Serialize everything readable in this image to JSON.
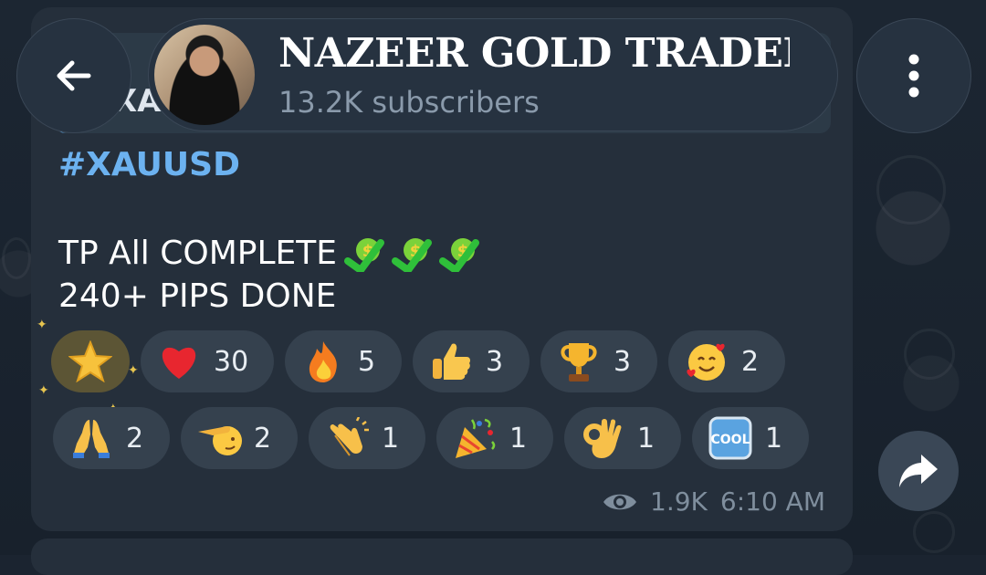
{
  "header": {
    "channel_name": "NAZEER GOLD TRADER",
    "subscribers": "13.2K subscribers"
  },
  "reply_preview": {
    "text": "XAU"
  },
  "message": {
    "hashtag": "#XAUUSD",
    "line1": "TP All COMPLETE",
    "line2": "240+ PIPS DONE",
    "views": "1.9K",
    "time": "6:10 AM"
  },
  "reactions": [
    {
      "icon": "star-icon",
      "count": ""
    },
    {
      "icon": "red-heart-icon",
      "count": "30"
    },
    {
      "icon": "fire-icon",
      "count": "5"
    },
    {
      "icon": "thumbs-up-icon",
      "count": "3"
    },
    {
      "icon": "trophy-icon",
      "count": "3"
    },
    {
      "icon": "smiling-face-with-hearts-icon",
      "count": "2"
    },
    {
      "icon": "folded-hands-icon",
      "count": "2"
    },
    {
      "icon": "saluting-hand-icon",
      "count": "2"
    },
    {
      "icon": "clapping-hands-icon",
      "count": "1"
    },
    {
      "icon": "party-popper-icon",
      "count": "1"
    },
    {
      "icon": "ok-hand-icon",
      "count": "1"
    },
    {
      "icon": "cool-button-icon",
      "count": "1"
    }
  ],
  "colors": {
    "background": "#1b2430",
    "bubble": "#252f3b",
    "hashtag": "#6cb2f0",
    "reaction_bg": "#35414e"
  }
}
